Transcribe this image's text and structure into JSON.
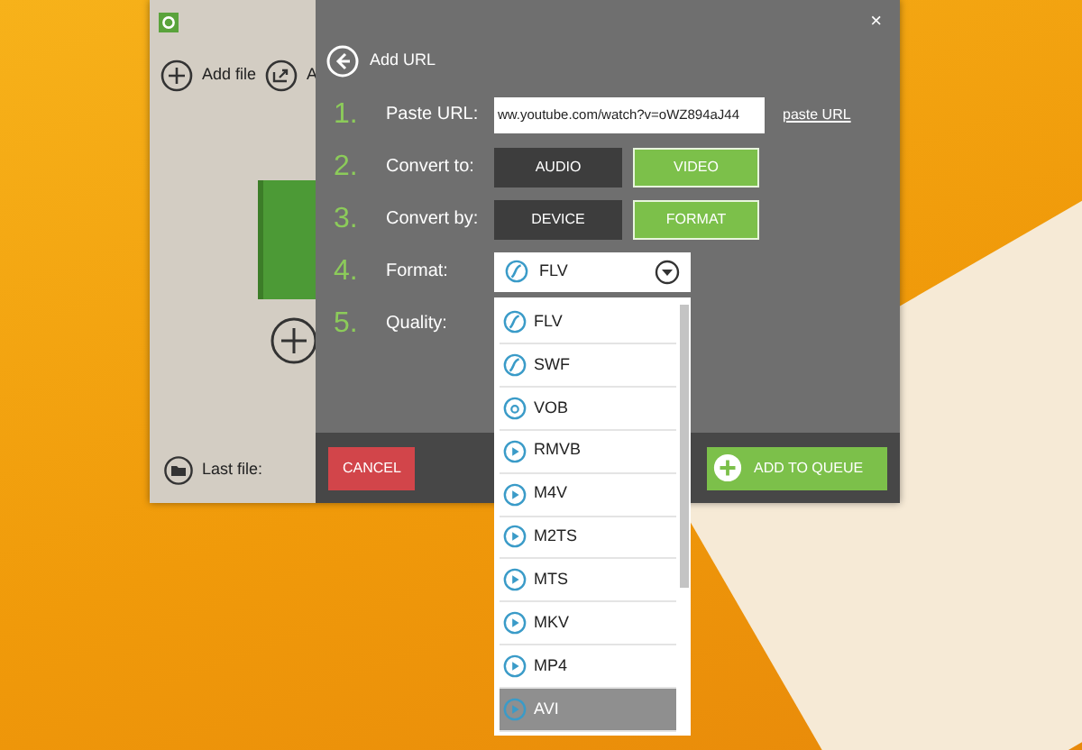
{
  "left_panel": {
    "toolbar": [
      {
        "label": "Add file",
        "kind": "plus"
      },
      {
        "label": "A",
        "kind": "share"
      }
    ],
    "last_file_label": "Last file:"
  },
  "dialog": {
    "title": "Add URL",
    "close": "×",
    "steps": [
      {
        "number": "1.",
        "label": "Paste URL:",
        "kind": "url",
        "value": "ww.youtube.com/watch?v=oWZ894aJ44",
        "link": "paste URL"
      },
      {
        "number": "2.",
        "label": "Convert to:",
        "kind": "choice",
        "options": [
          {
            "label": "AUDIO",
            "selected": false
          },
          {
            "label": "VIDEO",
            "selected": true
          }
        ]
      },
      {
        "number": "3.",
        "label": "Convert by:",
        "kind": "choice",
        "options": [
          {
            "label": "DEVICE",
            "selected": false
          },
          {
            "label": "FORMAT",
            "selected": true
          }
        ]
      },
      {
        "number": "4.",
        "label": "Format:",
        "kind": "select",
        "value": "FLV"
      },
      {
        "number": "5.",
        "label": "Quality:",
        "kind": "empty"
      }
    ],
    "format_options": [
      {
        "label": "FLV",
        "kind": "flash",
        "selected": false
      },
      {
        "label": "SWF",
        "kind": "flash",
        "selected": false
      },
      {
        "label": "VOB",
        "kind": "disc",
        "selected": false
      },
      {
        "label": "RMVB",
        "kind": "play",
        "selected": false
      },
      {
        "label": "M4V",
        "kind": "play",
        "selected": false
      },
      {
        "label": "M2TS",
        "kind": "play",
        "selected": false
      },
      {
        "label": "MTS",
        "kind": "play",
        "selected": false
      },
      {
        "label": "MKV",
        "kind": "play",
        "selected": false
      },
      {
        "label": "MP4",
        "kind": "play",
        "selected": false
      },
      {
        "label": "AVI",
        "kind": "play",
        "selected": true
      }
    ],
    "cancel": "CANCEL",
    "add_to_queue": "ADD TO QUEUE"
  }
}
